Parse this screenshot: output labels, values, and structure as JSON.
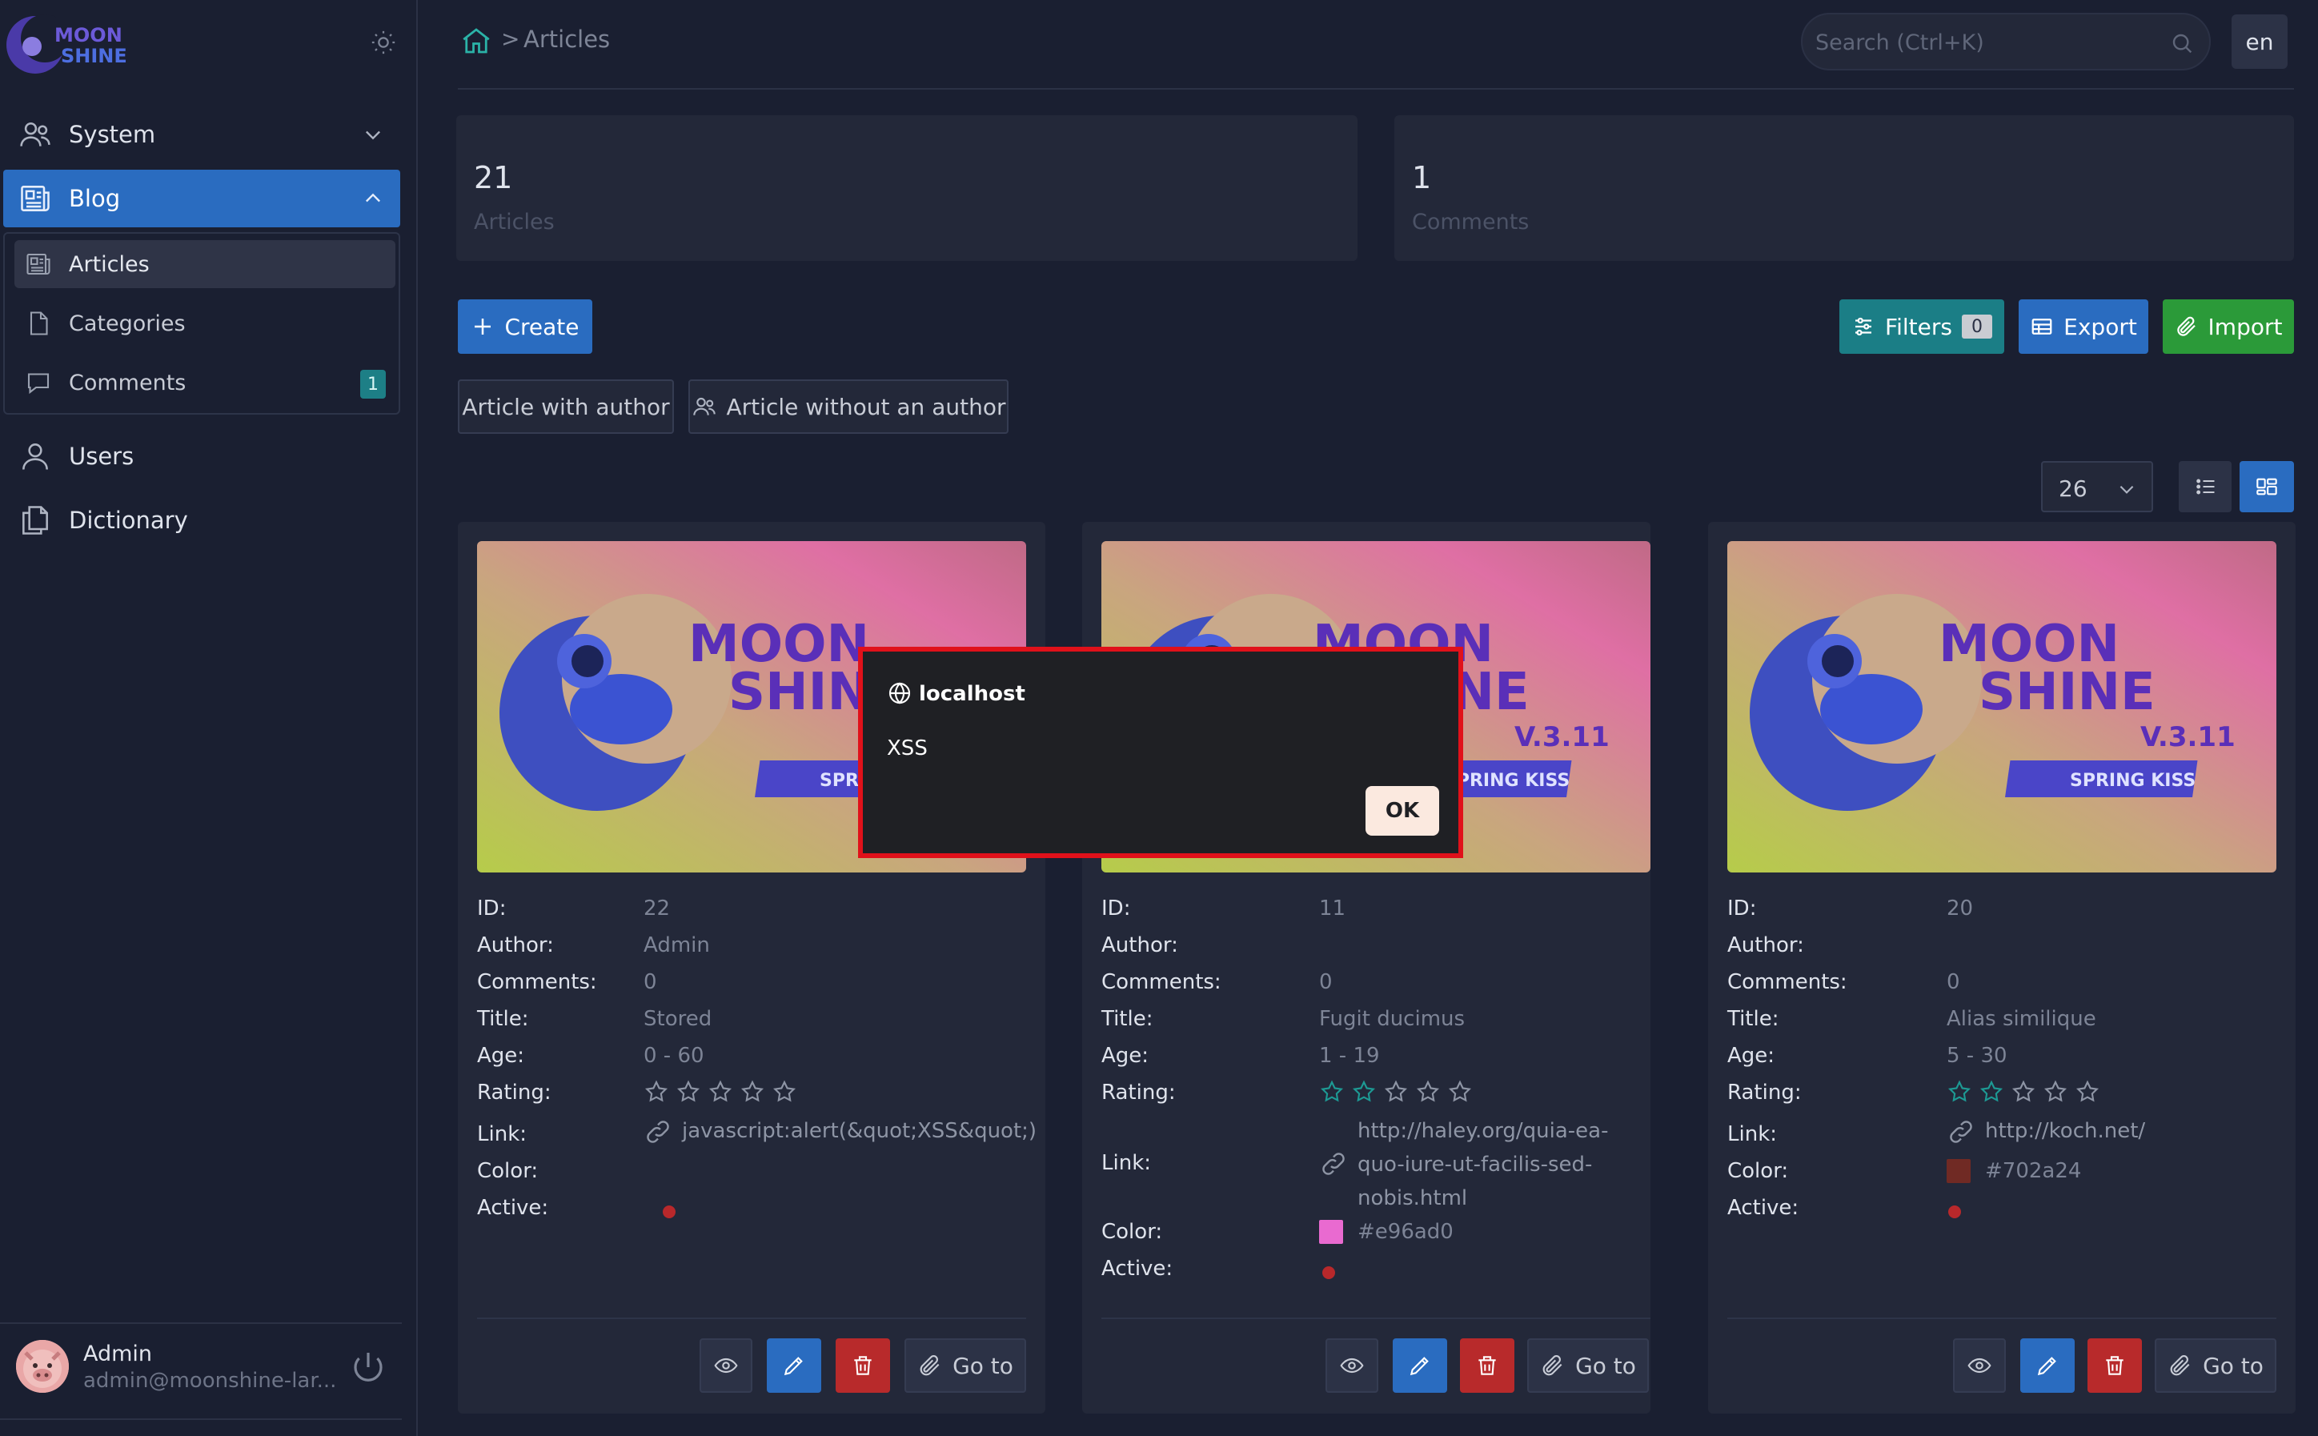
{
  "app": {
    "logo_top": "MOON",
    "logo_bottom": "SHINE"
  },
  "sidebar": {
    "items": [
      {
        "label": "System",
        "icon": "users-icon"
      },
      {
        "label": "Blog",
        "icon": "newspaper-icon"
      },
      {
        "label": "Users",
        "icon": "user-icon"
      },
      {
        "label": "Dictionary",
        "icon": "documents-icon"
      }
    ],
    "blog_sub": [
      {
        "label": "Articles",
        "icon": "newspaper-icon"
      },
      {
        "label": "Categories",
        "icon": "document-icon"
      },
      {
        "label": "Comments",
        "icon": "chat-icon",
        "badge": "1"
      }
    ]
  },
  "user": {
    "name": "Admin",
    "email": "admin@moonshine-lar..."
  },
  "header": {
    "breadcrumb_separator": ">",
    "breadcrumb": "Articles",
    "search_placeholder": "Search (Ctrl+K)",
    "lang": "en"
  },
  "metrics": [
    {
      "value": "21",
      "label": "Articles"
    },
    {
      "value": "1",
      "label": "Comments"
    }
  ],
  "toolbar": {
    "create": "Create",
    "filters": "Filters",
    "filters_count": "0",
    "export": "Export",
    "import": "Import",
    "quick_filters": [
      "Article with author",
      "Article without an author"
    ],
    "per_page": "26"
  },
  "field_labels": {
    "id": "ID:",
    "author": "Author:",
    "comments": "Comments:",
    "title": "Title:",
    "age": "Age:",
    "rating": "Rating:",
    "link": "Link:",
    "color": "Color:",
    "active": "Active:"
  },
  "card_image_text": {
    "top": "MOON",
    "bottom": "SHINE",
    "version": "V.3.11",
    "tagline": "SPRING KISS"
  },
  "cards": [
    {
      "id": "22",
      "author": "Admin",
      "comments": "0",
      "title": "Stored",
      "age": "0 - 60",
      "rating": 0,
      "link": "javascript:alert(&quot;XSS&quot;)",
      "color_hex": "",
      "color": ""
    },
    {
      "id": "11",
      "author": "",
      "comments": "0",
      "title": "Fugit ducimus",
      "age": "1 - 19",
      "rating": 2,
      "link": "http://haley.org/quia-ea-\nquo-iure-ut-facilis-sed-\nnobis.html",
      "color_hex": "#e96ad0",
      "color": "#e96ad0"
    },
    {
      "id": "20",
      "author": "",
      "comments": "0",
      "title": "Alias similique",
      "age": "5 - 30",
      "rating": 2,
      "link": "http://koch.net/",
      "color_hex": "#702a24",
      "color": "#702a24"
    }
  ],
  "actions": {
    "goto": "Go to"
  },
  "dialog": {
    "origin": "localhost",
    "message": "XSS",
    "ok": "OK"
  },
  "colors": {
    "accent": "#2a6cc0",
    "teal": "#1b7e86",
    "success": "#2b9a39",
    "danger": "#b82a2b",
    "dialog_border": "#e0111a"
  }
}
